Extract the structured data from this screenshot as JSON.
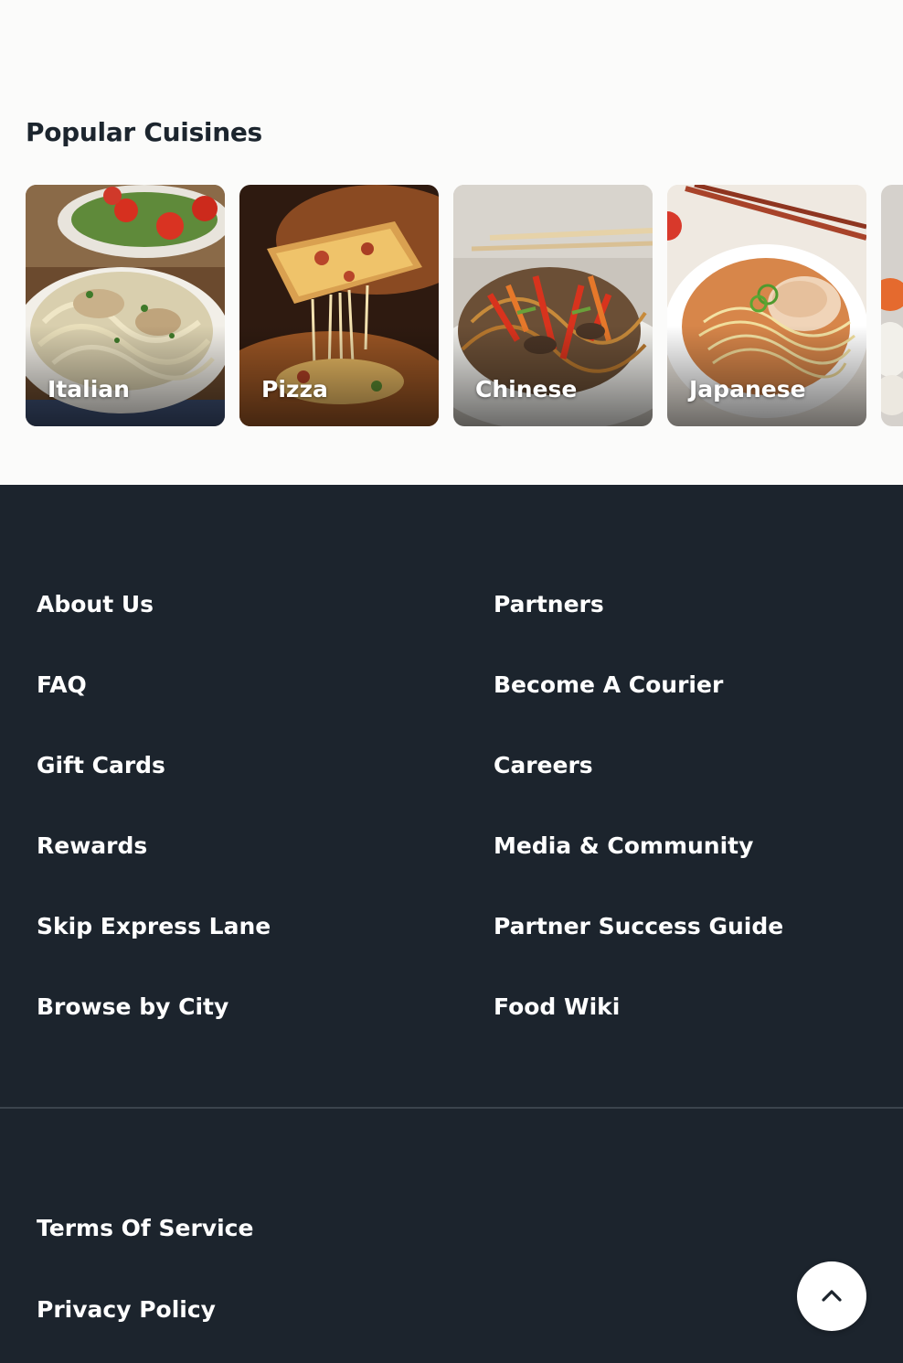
{
  "popular_cuisines": {
    "title": "Popular Cuisines",
    "items": [
      {
        "label": "Italian",
        "image": "pasta-photo"
      },
      {
        "label": "Pizza",
        "image": "pizza-photo"
      },
      {
        "label": "Chinese",
        "image": "noodles-photo"
      },
      {
        "label": "Japanese",
        "image": "ramen-photo"
      },
      {
        "label": "",
        "image": "sushi-photo"
      }
    ]
  },
  "footer": {
    "left_links": [
      "About Us",
      "FAQ",
      "Gift Cards",
      "Rewards",
      "Skip Express Lane",
      "Browse by City"
    ],
    "right_links": [
      "Partners",
      "Become A Courier",
      "Careers",
      "Media & Community",
      "Partner Success Guide",
      "Food Wiki"
    ],
    "legal_links": [
      "Terms Of Service",
      "Privacy Policy"
    ],
    "back_to_top_icon": "chevron-up-icon"
  },
  "colors": {
    "page_background": "#fbfbfa",
    "footer_background": "#1c242d",
    "heading_text": "#1c252e",
    "footer_text": "#ffffff"
  }
}
